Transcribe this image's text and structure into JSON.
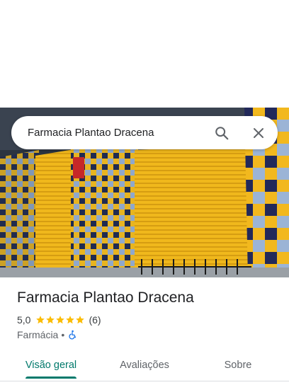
{
  "search": {
    "query": "Farmacia Plantao Dracena"
  },
  "icons": {
    "search": "search-icon",
    "close": "close-icon",
    "star": "star-icon",
    "wheelchair": "wheelchair-accessible-icon"
  },
  "place": {
    "name": "Farmacia Plantao Dracena",
    "rating": "5,0",
    "stars": 5,
    "review_count": "(6)",
    "category": "Farmácia",
    "separator": "•"
  },
  "tabs": [
    {
      "label": "Visão geral",
      "active": true
    },
    {
      "label": "Avaliações",
      "active": false
    },
    {
      "label": "Sobre",
      "active": false
    }
  ],
  "colors": {
    "accent": "#00796b",
    "star": "#fbbc04",
    "accessibility": "#1a73e8"
  }
}
